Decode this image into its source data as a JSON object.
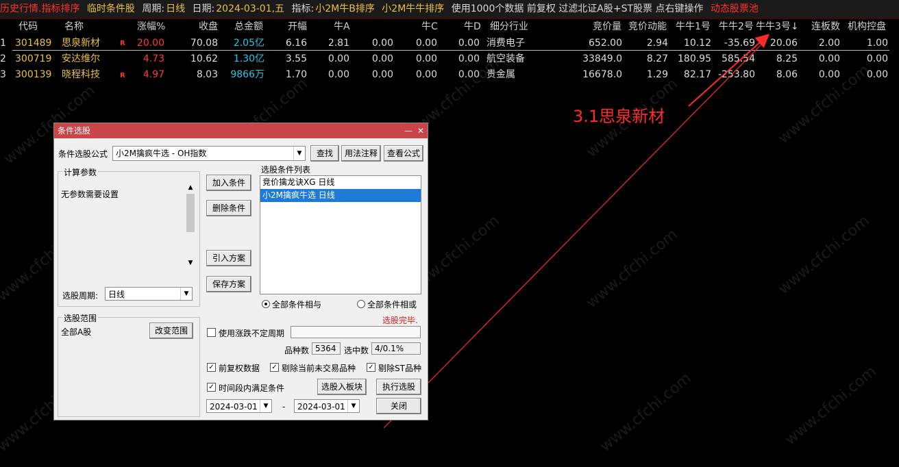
{
  "statusbar": {
    "seg1": "历史行情.指标排序",
    "seg2": "临时条件股",
    "period_label": "周期:",
    "period": "日线",
    "date_label": "日期:",
    "date": "2024-03-01,五",
    "indicator_label": "指标:",
    "indicator1": "小2M牛B排序",
    "indicator2": "小2M牛牛排序",
    "info": "使用1000个数据 前复权 过滤北证A股+ST股票 点右键操作",
    "pool": "动态股票池"
  },
  "table": {
    "headers": [
      "代码",
      "名称",
      "涨幅%",
      "收盘",
      "总金额",
      "开幅",
      "牛A",
      "",
      "牛C",
      "牛D",
      "细分行业",
      "竞价量",
      "竞价动能",
      "牛牛1号",
      "牛牛2号",
      "牛牛3号↓",
      "连板数",
      "机构控盘"
    ],
    "rows": [
      {
        "idx": "1",
        "code": "301489",
        "name": "思泉新材",
        "mark": "R",
        "chg": "20.00",
        "close": "70.08",
        "amount": "2.05亿",
        "open": "6.16",
        "a": "2.81",
        "b": "0.00",
        "c": "0.00",
        "d": "0.00",
        "industry": "消费电子",
        "bidvol": "652.00",
        "bidpow": "2.94",
        "n1": "10.12",
        "n2": "-35.69",
        "n3": "20.06",
        "lb": "2.00",
        "jg": "1.00"
      },
      {
        "idx": "2",
        "code": "300719",
        "name": "安达维尔",
        "mark": "",
        "chg": "4.73",
        "close": "10.62",
        "amount": "1.30亿",
        "open": "3.55",
        "a": "0.00",
        "b": "0.00",
        "c": "0.00",
        "d": "0.00",
        "industry": "航空装备",
        "bidvol": "33849.0",
        "bidpow": "8.27",
        "n1": "180.95",
        "n2": "585.54",
        "n3": "8.25",
        "lb": "0.00",
        "jg": "0.00"
      },
      {
        "idx": "3",
        "code": "300139",
        "name": "晓程科技",
        "mark": "R",
        "chg": "4.97",
        "close": "8.03",
        "amount": "9866万",
        "open": "1.70",
        "a": "0.00",
        "b": "0.00",
        "c": "0.00",
        "d": "0.00",
        "industry": "贵金属",
        "bidvol": "16678.0",
        "bidpow": "1.29",
        "n1": "82.17",
        "n2": "-253.80",
        "n3": "8.06",
        "lb": "0.00",
        "jg": "0.00"
      }
    ]
  },
  "annotation": "3.1思泉新材",
  "watermark": "www.cfchi.com",
  "dialog": {
    "title": "条件选股",
    "formula_label": "条件选股公式",
    "formula_value": "小2M擒疯牛选  -  OH指数",
    "find_btn": "查找",
    "usage_btn": "用法注释",
    "view_btn": "查看公式",
    "params_title": "计算参数",
    "params_text": "无参数需要设置",
    "period_label": "选股周期:",
    "period_value": "日线",
    "add_btn": "加入条件",
    "del_btn": "删除条件",
    "import_btn": "引入方案",
    "save_btn": "保存方案",
    "list_title": "选股条件列表",
    "conditions": [
      "竞价擒龙诀XG  日线",
      "小2M擒疯牛选  日线"
    ],
    "radio_and": "全部条件相与",
    "radio_or": "全部条件相或",
    "status": "选股完毕.",
    "range_title": "选股范围",
    "range_value": "全部A股",
    "change_range_btn": "改变范围",
    "use_period": "使用涨跌不定周期",
    "count_label": "品种数",
    "count_value": "5364",
    "selected_label": "选中数",
    "selected_value": "4/0.1%",
    "opt_fq": "前复权数据",
    "opt_notrade": "剔除当前未交易品种",
    "opt_st": "剔除ST品种",
    "opt_period": "时间段内满足条件",
    "to_block_btn": "选股入板块",
    "run_btn": "执行选股",
    "date_from": "2024-03-01",
    "date_sep": "-",
    "date_to": "2024-03-01",
    "close_btn": "关闭"
  },
  "colors": {
    "up": "#ff3a3a",
    "amount": "#25c8e8",
    "code": "#e8c040",
    "selection": "#1e7ad8",
    "dialog_title": "#c9454a"
  }
}
